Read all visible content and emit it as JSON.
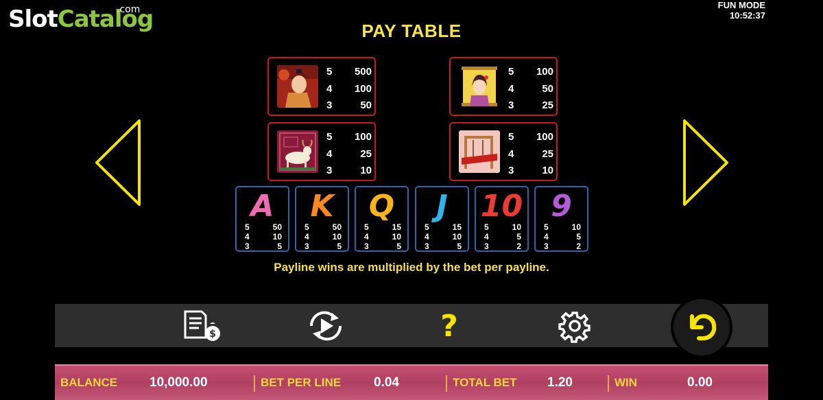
{
  "brand": {
    "slot": "Slot",
    "catalog": "Catalog",
    "dotcom": ".com"
  },
  "status": {
    "mode": "FUN MODE",
    "time": "10:52:37"
  },
  "title": "PAY TABLE",
  "premium_symbols": [
    {
      "name": "warrior",
      "pays": [
        [
          "5",
          "500"
        ],
        [
          "4",
          "100"
        ],
        [
          "3",
          "50"
        ]
      ]
    },
    {
      "name": "princess",
      "pays": [
        [
          "5",
          "100"
        ],
        [
          "4",
          "50"
        ],
        [
          "3",
          "25"
        ]
      ]
    },
    {
      "name": "ox",
      "pays": [
        [
          "5",
          "100"
        ],
        [
          "4",
          "25"
        ],
        [
          "3",
          "10"
        ]
      ]
    },
    {
      "name": "loom",
      "pays": [
        [
          "5",
          "100"
        ],
        [
          "4",
          "25"
        ],
        [
          "3",
          "10"
        ]
      ]
    }
  ],
  "card_symbols": [
    {
      "letter": "A",
      "color": "#f06bb0",
      "pays": [
        [
          "5",
          "50"
        ],
        [
          "4",
          "10"
        ],
        [
          "3",
          "5"
        ]
      ]
    },
    {
      "letter": "K",
      "color": "#f7891f",
      "pays": [
        [
          "5",
          "50"
        ],
        [
          "4",
          "10"
        ],
        [
          "3",
          "5"
        ]
      ]
    },
    {
      "letter": "Q",
      "color": "#f6b31b",
      "pays": [
        [
          "5",
          "15"
        ],
        [
          "4",
          "10"
        ],
        [
          "3",
          "5"
        ]
      ]
    },
    {
      "letter": "J",
      "color": "#2cb7e6",
      "pays": [
        [
          "5",
          "15"
        ],
        [
          "4",
          "10"
        ],
        [
          "3",
          "5"
        ]
      ]
    },
    {
      "letter": "10",
      "color": "#ee3a35",
      "pays": [
        [
          "5",
          "10"
        ],
        [
          "4",
          "5"
        ],
        [
          "3",
          "2"
        ]
      ]
    },
    {
      "letter": "9",
      "color": "#b45ad6",
      "pays": [
        [
          "5",
          "10"
        ],
        [
          "4",
          "5"
        ],
        [
          "3",
          "2"
        ]
      ]
    }
  ],
  "note": "Payline wins are multiplied by the bet per payline.",
  "toolbar": {
    "icons": [
      "paytable-icon",
      "autoplay-icon",
      "help-icon",
      "settings-icon",
      "back-icon"
    ],
    "help_glyph": "?"
  },
  "bottom_bar": {
    "balance_label": "BALANCE",
    "balance_value": "10,000.00",
    "bet_line_label": "BET PER LINE",
    "bet_line_value": "0.04",
    "total_bet_label": "TOTAL BET",
    "total_bet_value": "1.20",
    "win_label": "WIN",
    "win_value": "0.00"
  },
  "colors": {
    "title": "#f7e34a",
    "premium_border": "#c8171e",
    "card_border": "#2a65b0",
    "nav_arrow": "#f5e400",
    "accent_green": "#8cc63f"
  }
}
